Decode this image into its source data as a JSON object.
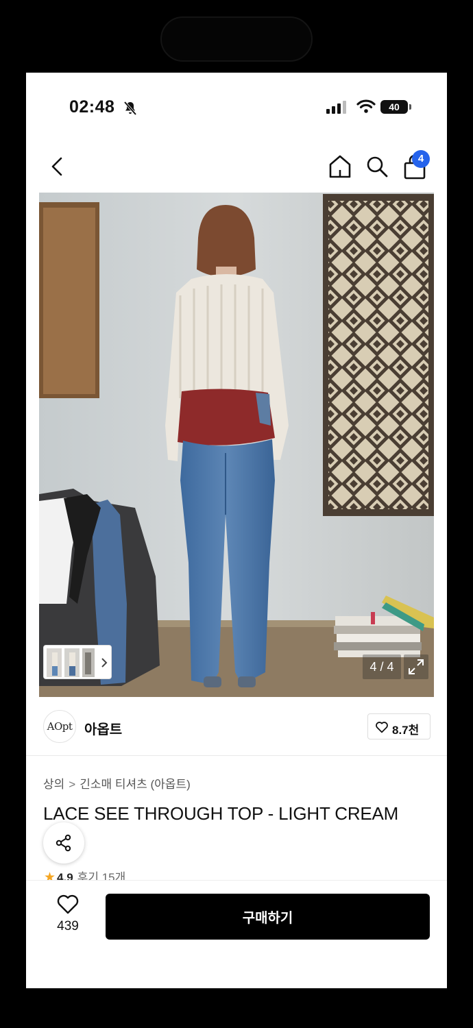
{
  "status_bar": {
    "time": "02:48",
    "battery": "40"
  },
  "header": {
    "cart_count": "4"
  },
  "gallery": {
    "counter": "4 / 4"
  },
  "brand": {
    "logo_text": "AOpt",
    "name": "아옵트",
    "likes": "8.7천"
  },
  "breadcrumb": {
    "category": "상의",
    "subcategory": "긴소매 티셔츠 (아옵트)"
  },
  "product": {
    "title": "LACE SEE THROUGH TOP - LIGHT CREAM",
    "rating": "4.9",
    "reviews": "후기 15개"
  },
  "bottom_bar": {
    "wish_count": "439",
    "buy_label": "구매하기"
  },
  "colors": {
    "badge": "#2563eb",
    "star": "#f5a623",
    "buy_button": "#000000"
  }
}
